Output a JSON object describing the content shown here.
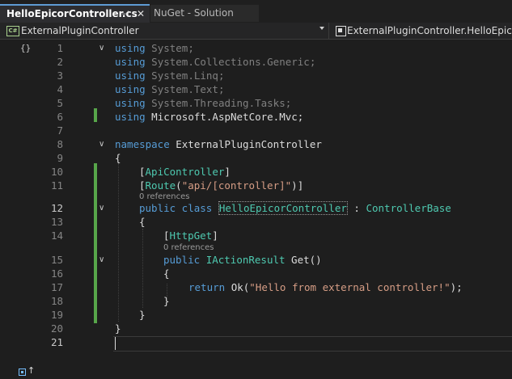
{
  "tabs": {
    "active": {
      "label": "HelloEpicorController.cs",
      "pin": "⊣",
      "close": "✕"
    },
    "inactive": {
      "label": "NuGet - Solution"
    }
  },
  "navbar": {
    "project_icon": "C#",
    "project": "ExternalPluginController",
    "member": "ExternalPluginController.HelloEpicorCo"
  },
  "gutter": {
    "toolbar_icon": "{}"
  },
  "code": {
    "l1": {
      "n": "1",
      "kw": "using",
      "rest": " System;"
    },
    "l2": {
      "n": "2",
      "kw": "using",
      "rest": " System.Collections.Generic;"
    },
    "l3": {
      "n": "3",
      "kw": "using",
      "rest": " System.Linq;"
    },
    "l4": {
      "n": "4",
      "kw": "using",
      "rest": " System.Text;"
    },
    "l5": {
      "n": "5",
      "kw": "using",
      "rest": " System.Threading.Tasks;"
    },
    "l6": {
      "n": "6",
      "kw": "using",
      "rest": " Microsoft.AspNetCore.Mvc;"
    },
    "l7": {
      "n": "7"
    },
    "l8": {
      "n": "8",
      "kw": "namespace",
      "rest": " ExternalPluginController"
    },
    "l9": {
      "n": "9",
      "text": "{"
    },
    "l10": {
      "n": "10",
      "open": "[",
      "attr": "ApiController",
      "close": "]"
    },
    "l11": {
      "n": "11",
      "open": "[",
      "attr": "Route",
      "paren_open": "(",
      "str": "\"api/[controller]\"",
      "paren_close": ")]"
    },
    "refs1": "0 references",
    "l12": {
      "n": "12",
      "kw": "public class ",
      "cls": "HelloEpicorController",
      "colon": " : ",
      "base": "ControllerBase"
    },
    "l13": {
      "n": "13",
      "text": "{"
    },
    "l14": {
      "n": "14",
      "open": "[",
      "attr": "HttpGet",
      "close": "]"
    },
    "refs2": "0 references",
    "l15": {
      "n": "15",
      "kw": "public ",
      "type": "IActionResult",
      "rest": " Get()"
    },
    "l16": {
      "n": "16",
      "text": "{"
    },
    "l17": {
      "n": "17",
      "kw": "return ",
      "fn": "Ok(",
      "str": "\"Hello from external controller!\"",
      "end": ");"
    },
    "l18": {
      "n": "18",
      "text": "}"
    },
    "l19": {
      "n": "19",
      "text": "}"
    },
    "l20": {
      "n": "20",
      "text": "}"
    },
    "l21": {
      "n": "21"
    }
  },
  "colors": {
    "keyword": "#569cd6",
    "type": "#4ec9b0",
    "string": "#d69d85",
    "change_bar": "#57a64a",
    "tab_accent": "#5e9bd3"
  }
}
